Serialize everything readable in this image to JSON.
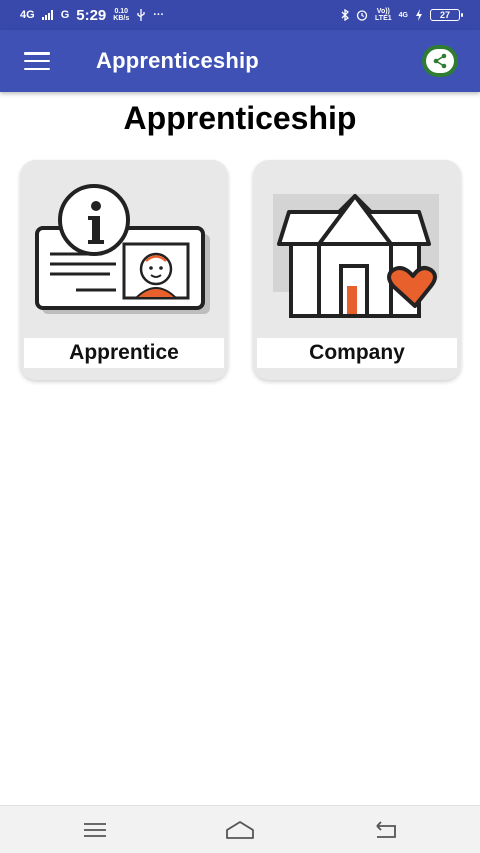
{
  "status_bar": {
    "network1": "4G",
    "network2": "G",
    "time": "5:29",
    "data_speed_value": "0.10",
    "data_speed_unit": "KB/s",
    "overflow": "···",
    "volte_top": "Vo))",
    "volte_bottom": "LTE1",
    "network3_top": "4G",
    "battery": "27",
    "icons": [
      "signal-icon",
      "usb-icon",
      "bluetooth-icon",
      "alarm-icon",
      "charging-icon",
      "battery-icon"
    ]
  },
  "app_bar": {
    "title": "Apprenticeship",
    "menu_icon": "hamburger-menu-icon",
    "share_icon": "share-icon",
    "color": "#3f51b5"
  },
  "page": {
    "heading": "Apprenticeship"
  },
  "cards": [
    {
      "label": "Apprentice",
      "icon": "id-card-icon"
    },
    {
      "label": "Company",
      "icon": "house-heart-icon"
    }
  ],
  "nav_bar": {
    "icons": [
      "recent-apps-icon",
      "home-icon",
      "back-icon"
    ]
  },
  "colors": {
    "primary": "#3f51b5",
    "status_bar": "#3949ab",
    "share_button": "#2e7d32",
    "accent_orange": "#e8602c",
    "card_background": "#e8e8e8"
  }
}
